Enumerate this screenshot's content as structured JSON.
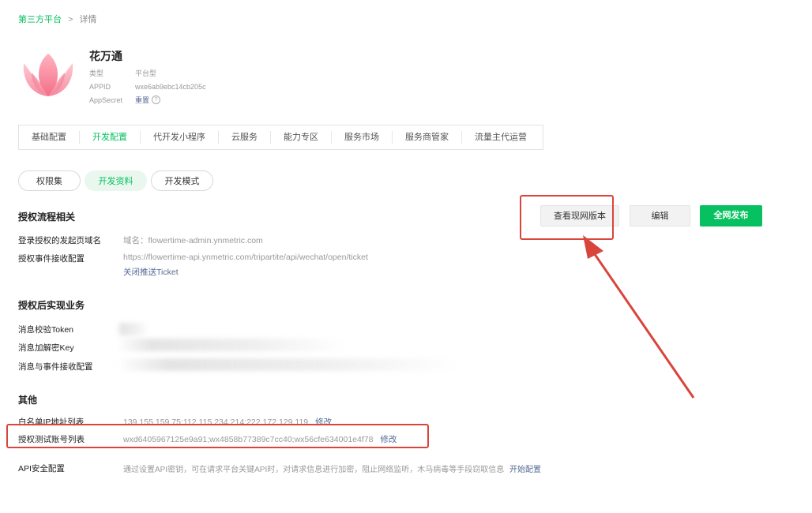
{
  "breadcrumb": {
    "parent": "第三方平台",
    "separator": ">",
    "current": "详情"
  },
  "app": {
    "name": "花万通",
    "type_label": "类型",
    "type_value": "平台型",
    "appid_label": "APPID",
    "appid_value": "wxe6ab9ebc14cb205c",
    "secret_label": "AppSecret",
    "secret_action": "重置",
    "help": "?"
  },
  "tabs": [
    "基础配置",
    "开发配置",
    "代开发小程序",
    "云服务",
    "能力专区",
    "服务市场",
    "服务商管家",
    "流量主代运营"
  ],
  "active_tab": "开发配置",
  "subtabs": [
    "权限集",
    "开发资料",
    "开发模式"
  ],
  "buttons": {
    "view_current": "查看现网版本",
    "edit": "编辑",
    "publish": "全网发布"
  },
  "auth_flow": {
    "title": "授权流程相关",
    "domain_label": "登录授权的发起页域名",
    "domain_value": "域名：flowertime-admin.ynmetric.com",
    "event_label": "授权事件接收配置",
    "event_value": "https://flowertime-api.ynmetric.com/tripartite/api/wechat/open/ticket",
    "event_action": "关闭推送Ticket"
  },
  "post_auth": {
    "title": "授权后实现业务",
    "token_label": "消息校验Token",
    "key_label": "消息加解密Key",
    "event_label": "消息与事件接收配置"
  },
  "other": {
    "title": "其他",
    "whitelist_label": "白名单IP地址列表",
    "whitelist_value": "139.155.159.75;112.115.234.214;222.172.129.119",
    "whitelist_action": "修改",
    "test_label": "授权测试账号列表",
    "test_value": "wxd6405967125e9a91;wx4858b77389c7cc40;wx56cfe634001e4f78",
    "test_action": "修改",
    "api_label": "API安全配置",
    "api_value": "通过设置API密钥，可在请求平台关键API时，对请求信息进行加密，阻止网络监听，木马病毒等手段窃取信息",
    "api_action": "开始配置"
  },
  "colors": {
    "accent": "#07c160",
    "link": "#576b95",
    "annotation": "#d9453b"
  }
}
